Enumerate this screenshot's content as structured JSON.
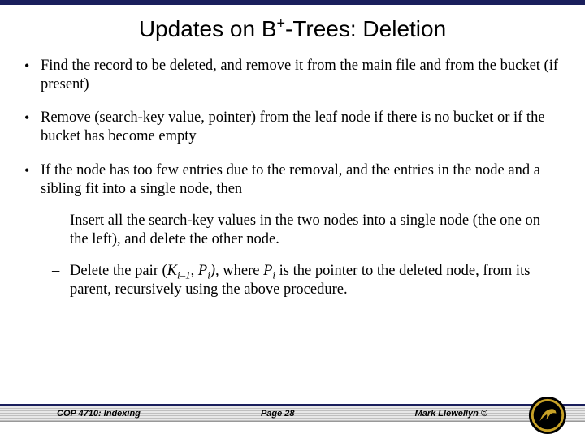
{
  "title_pre": "Updates on B",
  "title_sup": "+",
  "title_post": "-Trees: Deletion",
  "bullets": {
    "b1": "Find the record to be deleted, and remove it from the main file and from the bucket (if present)",
    "b2": "Remove (search-key value, pointer) from the leaf node if there is no bucket or if the bucket has become empty",
    "b3": "If the node has too few entries due to the removal, and the entries in the node and a sibling fit into a single node, then",
    "s1": "Insert all the search-key values in the two nodes into a single node (the one on the left), and delete the other node.",
    "s2_a": "Delete the pair (",
    "s2_K": "K",
    "s2_i1": "i–1",
    "s2_comma": ", ",
    "s2_P": "P",
    "s2_i": "i",
    "s2_b": "), ",
    "s2_c": "where ",
    "s2_P2": "P",
    "s2_i2": "i",
    "s2_d": " is the pointer to the deleted node, from its parent, recursively using the above procedure."
  },
  "footer": {
    "left": "COP 4710: Indexing",
    "center": "Page 28",
    "right": "Mark Llewellyn ©"
  }
}
